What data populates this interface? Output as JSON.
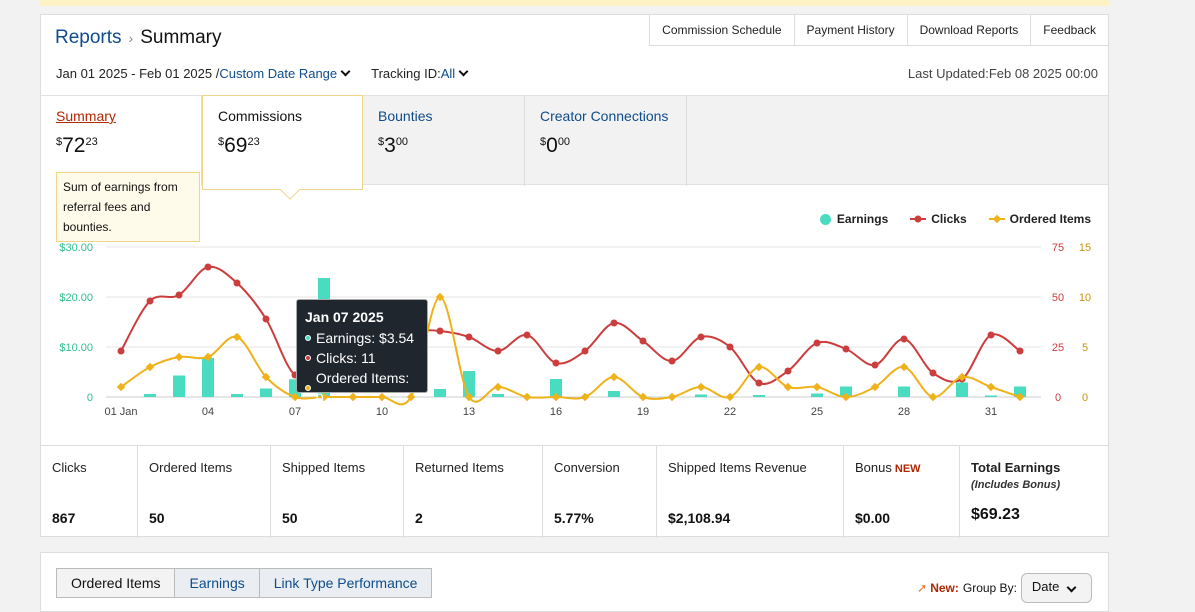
{
  "breadcrumb": {
    "parent": "Reports",
    "current": "Summary"
  },
  "top_links": [
    "Commission Schedule",
    "Payment History",
    "Download Reports",
    "Feedback"
  ],
  "date_range": {
    "text": "Jan 01 2025 - Feb 01 2025 /",
    "custom_label": "Custom Date Range"
  },
  "tracking": {
    "label": "Tracking ID:",
    "value": "All"
  },
  "last_updated": "Last Updated:Feb 08 2025 00:00",
  "tabs": [
    {
      "name": "Summary",
      "currency": "$",
      "whole": "72",
      "cents": "23"
    },
    {
      "name": "Commissions",
      "currency": "$",
      "whole": "69",
      "cents": "23"
    },
    {
      "name": "Bounties",
      "currency": "$",
      "whole": "3",
      "cents": "00"
    },
    {
      "name": "Creator Connections",
      "currency": "$",
      "whole": "0",
      "cents": "00"
    }
  ],
  "summary_tooltip": "Sum of earnings from referral fees and bounties.",
  "legend": {
    "earnings": "Earnings",
    "clicks": "Clicks",
    "ordered": "Ordered Items"
  },
  "colors": {
    "earnings": "#49dcc0",
    "clicks": "#cc3d3d",
    "ordered": "#efb21b",
    "link": "#0f4c8a",
    "alert": "#b12704"
  },
  "hover_tooltip": {
    "title": "Jan 07 2025",
    "earnings": "Earnings: $3.54",
    "clicks": "Clicks: 11",
    "ordered": "Ordered Items: 0"
  },
  "chart_data": {
    "type": "bar",
    "x_ticks": [
      "01 Jan",
      "04",
      "07",
      "10",
      "13",
      "16",
      "19",
      "22",
      "25",
      "28",
      "31"
    ],
    "y_left_ticks": [
      "0",
      "$10.00",
      "$20.00",
      "$30.00"
    ],
    "y_right_clicks_ticks": [
      "0",
      "25",
      "50",
      "75"
    ],
    "y_right_ordered_ticks": [
      "0",
      "5",
      "10",
      "15"
    ],
    "series": [
      {
        "name": "Earnings",
        "type": "bar",
        "axis": "left",
        "ylim": [
          0,
          30
        ],
        "values": [
          0,
          0.6,
          4.3,
          7.8,
          0.6,
          1.7,
          3.54,
          23.8,
          0,
          0,
          0,
          1.6,
          5.2,
          0.6,
          0,
          3.6,
          0,
          1.2,
          0,
          0,
          0.5,
          0,
          0.4,
          0,
          0.7,
          2.1,
          0,
          2.1,
          0,
          2.9,
          0.3,
          2.1
        ]
      },
      {
        "name": "Clicks",
        "type": "line",
        "axis": "right",
        "ylim": [
          0,
          75
        ],
        "values": [
          23,
          48,
          51,
          65,
          57,
          39,
          11,
          17,
          21,
          28,
          33,
          33,
          30,
          23,
          31,
          17,
          23,
          37,
          28,
          18,
          30,
          25,
          7,
          13,
          27,
          24,
          16,
          29,
          12,
          9,
          31,
          23
        ]
      },
      {
        "name": "Ordered Items",
        "type": "line",
        "axis": "right",
        "ylim": [
          0,
          15
        ],
        "values": [
          1,
          3,
          4,
          4,
          6,
          2,
          0,
          0,
          0,
          0,
          0,
          10,
          0,
          1,
          0,
          0,
          0,
          2,
          0,
          0,
          1,
          0,
          3,
          1,
          1,
          0,
          1,
          3,
          0,
          2,
          1,
          0
        ]
      }
    ]
  },
  "stats": [
    {
      "label": "Clicks",
      "value": "867"
    },
    {
      "label": "Ordered Items",
      "value": "50"
    },
    {
      "label": "Shipped Items",
      "value": "50"
    },
    {
      "label": "Returned Items",
      "value": "2"
    },
    {
      "label": "Conversion",
      "value": "5.77%"
    },
    {
      "label": "Shipped Items Revenue",
      "value": "$2,108.94"
    },
    {
      "label": "Bonus",
      "badge": "NEW",
      "value": "$0.00"
    },
    {
      "label": "Total Earnings",
      "sub": "(Includes Bonus)",
      "value": "$69.23"
    }
  ],
  "bottom_tabs": [
    "Ordered Items",
    "Earnings",
    "Link Type Performance"
  ],
  "group_by": {
    "new": "New:",
    "label": "Group By:",
    "value": "Date"
  }
}
